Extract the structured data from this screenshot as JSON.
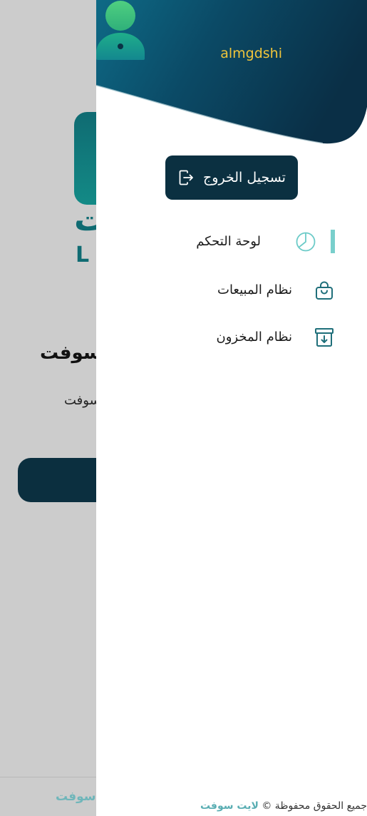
{
  "background": {
    "logo_letter": "L",
    "logo_text": "ت",
    "welcome_title": "سوفت!",
    "welcome_subtitle": "سوفت",
    "footer_brand": "سوفت"
  },
  "drawer": {
    "user": {
      "name": "almgdshi"
    },
    "logout_label": "تسجيل الخروج",
    "menu": [
      {
        "label": "لوحة التحكم",
        "icon": "pie-chart-icon",
        "active": true
      },
      {
        "label": "نظام المبيعات",
        "icon": "shopping-bag-icon",
        "active": false
      },
      {
        "label": "نظام المخزون",
        "icon": "archive-box-icon",
        "active": false
      }
    ],
    "footer": {
      "rights_text": "جميع الحقوق محفوظة ©",
      "brand": "لايت سوفت"
    }
  },
  "colors": {
    "header_dark": "#0b3a52",
    "header_teal": "#137e86",
    "accent_teal": "#79cfcc",
    "button_dark": "#0b3041",
    "username_yellow": "#f0c53a",
    "icon_teal": "#1f6f7a"
  }
}
